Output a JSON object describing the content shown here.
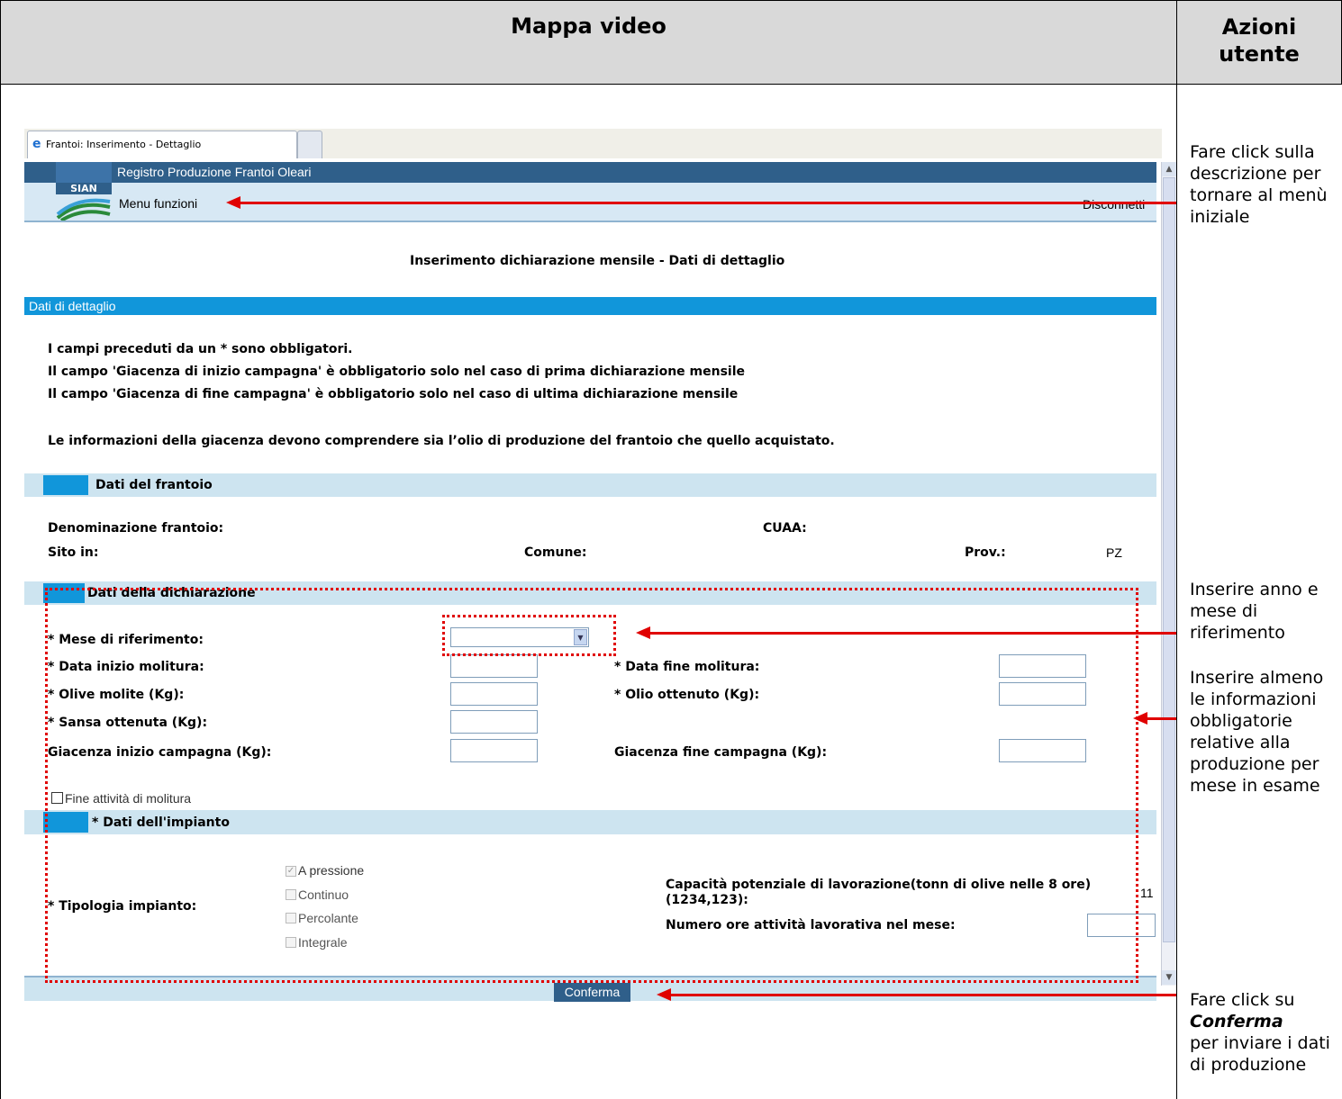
{
  "doc_header": {
    "left_title": "Mappa video",
    "right_title": "Azioni utente"
  },
  "notes": {
    "menu": "Fare click sulla descrizione per tornare al menù iniziale",
    "month": "Inserire anno e mese di riferimento",
    "mandatory": "Inserire almeno le informazioni obbligatorie relative alla produzione per mese in esame",
    "confirm_prefix": "Fare click su",
    "confirm_bold": "Conferma",
    "confirm_suffix": "per inviare i dati di produzione"
  },
  "browser": {
    "tab_title": "Frantoi: Inserimento - Dettaglio"
  },
  "app": {
    "title": "Registro Produzione Frantoi Oleari",
    "logo": "SIAN",
    "menu": "Menu funzioni",
    "logout": "Disconnetti",
    "page_title": "Inserimento dichiarazione mensile - Dati di dettaglio",
    "details_bar": "Dati di dettaglio",
    "info_lines": [
      "I campi preceduti da un * sono obbligatori.",
      "Il campo 'Giacenza di inizio campagna' è obbligatorio solo nel caso di prima dichiarazione mensile",
      "Il campo 'Giacenza di fine campagna' è obbligatorio solo nel caso di ultima dichiarazione mensile",
      "Le informazioni della giacenza devono comprendere sia l’olio di produzione del frantoio che quello acquistato."
    ]
  },
  "frantoio": {
    "section": "Dati del frantoio",
    "denominazione_label": "Denominazione frantoio:",
    "cuaa_label": "CUAA:",
    "sito_label": "Sito in:",
    "comune_label": "Comune:",
    "prov_label": "Prov.:",
    "prov_value": "PZ"
  },
  "dichiarazione": {
    "section": "Dati della dichiarazione",
    "mese_label": "* Mese di riferimento:",
    "mese_value": "",
    "data_inizio_label": "* Data inizio molitura:",
    "data_fine_label": "* Data fine molitura:",
    "olive_label": "* Olive molite (Kg):",
    "olio_label": "* Olio ottenuto (Kg):",
    "sansa_label": "* Sansa ottenuta (Kg):",
    "giac_inizio_label": "Giacenza inizio campagna (Kg):",
    "giac_fine_label": "Giacenza fine campagna (Kg):",
    "fine_attivita_label": "Fine attività di molitura"
  },
  "impianto": {
    "section": "* Dati dell'impianto",
    "tipologia_label": "* Tipologia impianto:",
    "options": [
      "A pressione",
      "Continuo",
      "Percolante",
      "Integrale"
    ],
    "capacita_label": "Capacità potenziale di lavorazione(tonn di olive nelle 8 ore)",
    "capacita_label2": "(1234,123):",
    "capacita_value": "11",
    "ore_label": "Numero ore attività lavorativa nel mese:"
  },
  "confirm_button": "Conferma"
}
